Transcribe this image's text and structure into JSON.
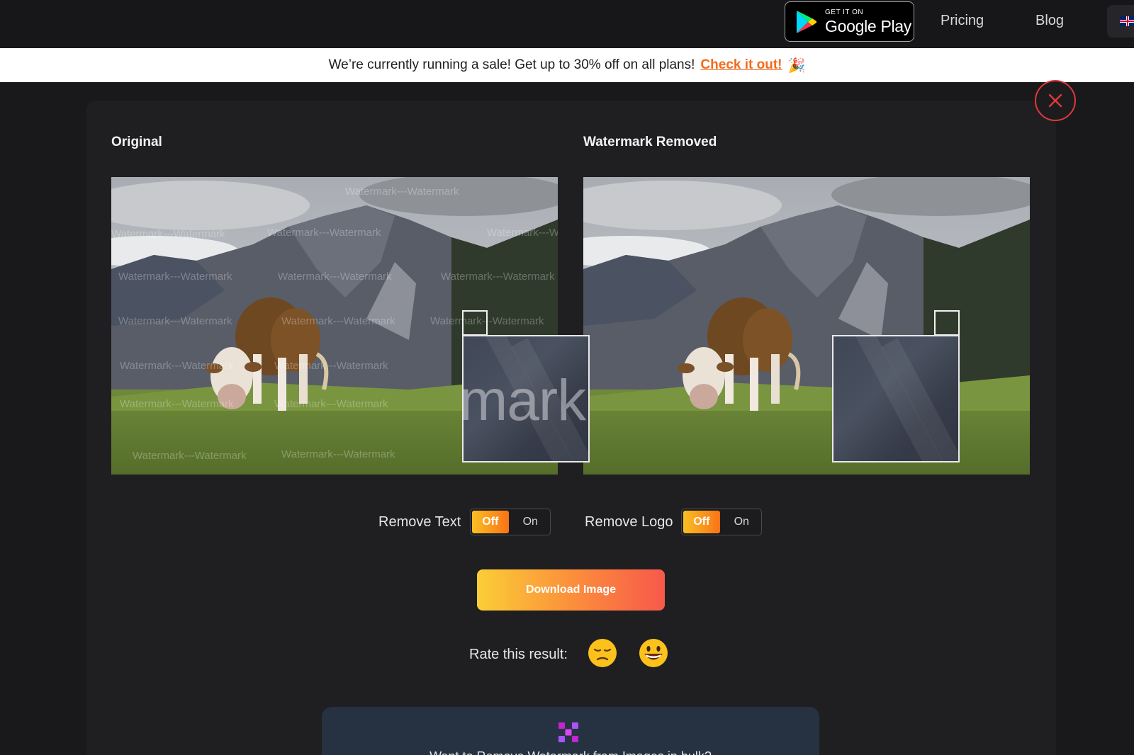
{
  "nav": {
    "google_play_small": "GET IT ON",
    "google_play_big": "Google Play",
    "pricing": "Pricing",
    "blog": "Blog",
    "language_icon": "uk-flag-icon"
  },
  "banner": {
    "text": "We’re currently running a sale! Get up to 30% off on all plans!",
    "cta": "Check it out!",
    "emoji": "🎉"
  },
  "comparison": {
    "original_title": "Original",
    "removed_title": "Watermark Removed",
    "watermark_text": "Watermark---Watermark",
    "loupe_text": "mark"
  },
  "controls": {
    "remove_text_label": "Remove Text",
    "remove_logo_label": "Remove Logo",
    "off_label": "Off",
    "on_label": "On",
    "remove_text_state": "Off",
    "remove_logo_state": "Off",
    "download_label": "Download Image"
  },
  "rating": {
    "label": "Rate this result:",
    "options": [
      "😔",
      "😀"
    ]
  },
  "bulk": {
    "text": "Want to Remove Watermark from Images in bulk?"
  },
  "colors": {
    "accent_orange": "#f26b1d",
    "close_red": "#e0383b",
    "gradient_start": "#fbce36",
    "gradient_end": "#f7594b"
  }
}
